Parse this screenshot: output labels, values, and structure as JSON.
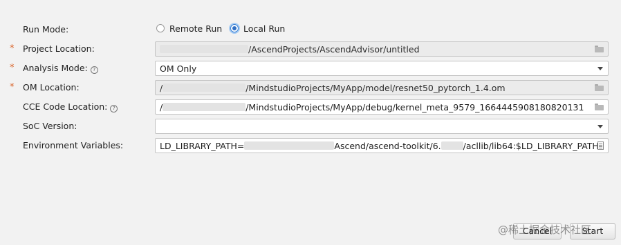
{
  "run_mode": {
    "label": "Run Mode:",
    "options": [
      "Remote Run",
      "Local Run"
    ],
    "selected": "Local Run"
  },
  "project_location": {
    "required_mark": "*",
    "label": "Project Location:",
    "value": "/AscendProjects/AscendAdvisor/untitled"
  },
  "analysis_mode": {
    "required_mark": "*",
    "label": "Analysis Mode:",
    "help": "?",
    "value": "OM Only"
  },
  "om_location": {
    "required_mark": "*",
    "label": "OM Location:",
    "prefix": "/",
    "value": "/MindstudioProjects/MyApp/model/resnet50_pytorch_1.4.om"
  },
  "cce_code_location": {
    "label": "CCE Code Location:",
    "help": "?",
    "prefix": "/",
    "value": "/MindstudioProjects/MyApp/debug/kernel_meta_9579_1664445908180820131"
  },
  "soc_version": {
    "label": "SoC Version:",
    "value": ""
  },
  "environment_variables": {
    "label": "Environment Variables:",
    "part1": "LD_LIBRARY_PATH=",
    "part2": "Ascend/ascend-toolkit/6.",
    "part3": "/acllib/lib64:$LD_LIBRARY_PATH"
  },
  "buttons": {
    "cancel": "Cancel",
    "start": "Start"
  },
  "watermark": "@稀土掘金技术社区"
}
